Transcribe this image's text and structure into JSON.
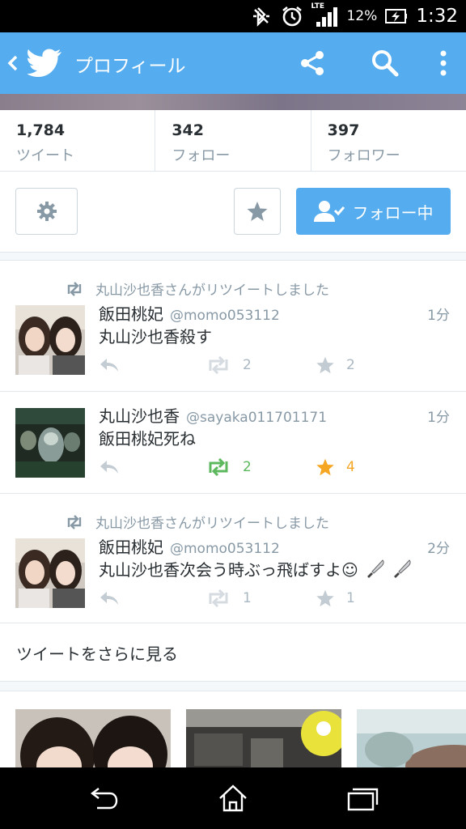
{
  "status_bar": {
    "battery": "12%",
    "time": "1:32",
    "network": "LTE"
  },
  "action_bar": {
    "title": "プロフィール"
  },
  "stats": [
    {
      "count": "1,784",
      "label": "ツイート"
    },
    {
      "count": "342",
      "label": "フォロー"
    },
    {
      "count": "397",
      "label": "フォロワー"
    }
  ],
  "buttons": {
    "follow_label": "フォロー中"
  },
  "tweets": [
    {
      "retweet_note": "丸山沙也香さんがリツイートしました",
      "name": "飯田桃妃",
      "handle": "@momo053112",
      "time": "1分",
      "text": "丸山沙也香殺す",
      "retweets": "2",
      "favorites": "2",
      "retweeted": false,
      "favorited": false
    },
    {
      "retweet_note": "",
      "name": "丸山沙也香",
      "handle": "@sayaka011701171",
      "time": "1分",
      "text": "飯田桃妃死ね",
      "retweets": "2",
      "favorites": "4",
      "retweeted": true,
      "favorited": true
    },
    {
      "retweet_note": "丸山沙也香さんがリツイートしました",
      "name": "飯田桃妃",
      "handle": "@momo053112",
      "time": "2分",
      "text": "丸山沙也香次会う時ぶっ飛ばすよ☺",
      "retweets": "1",
      "favorites": "1",
      "retweeted": false,
      "favorited": false
    }
  ],
  "more_tweets_label": "ツイートをさらに見る",
  "colors": {
    "brand_blue": "#55acee",
    "retweet_green": "#5cb85c",
    "favorite_gold": "#f5a623",
    "muted_gray": "#8899a6"
  }
}
